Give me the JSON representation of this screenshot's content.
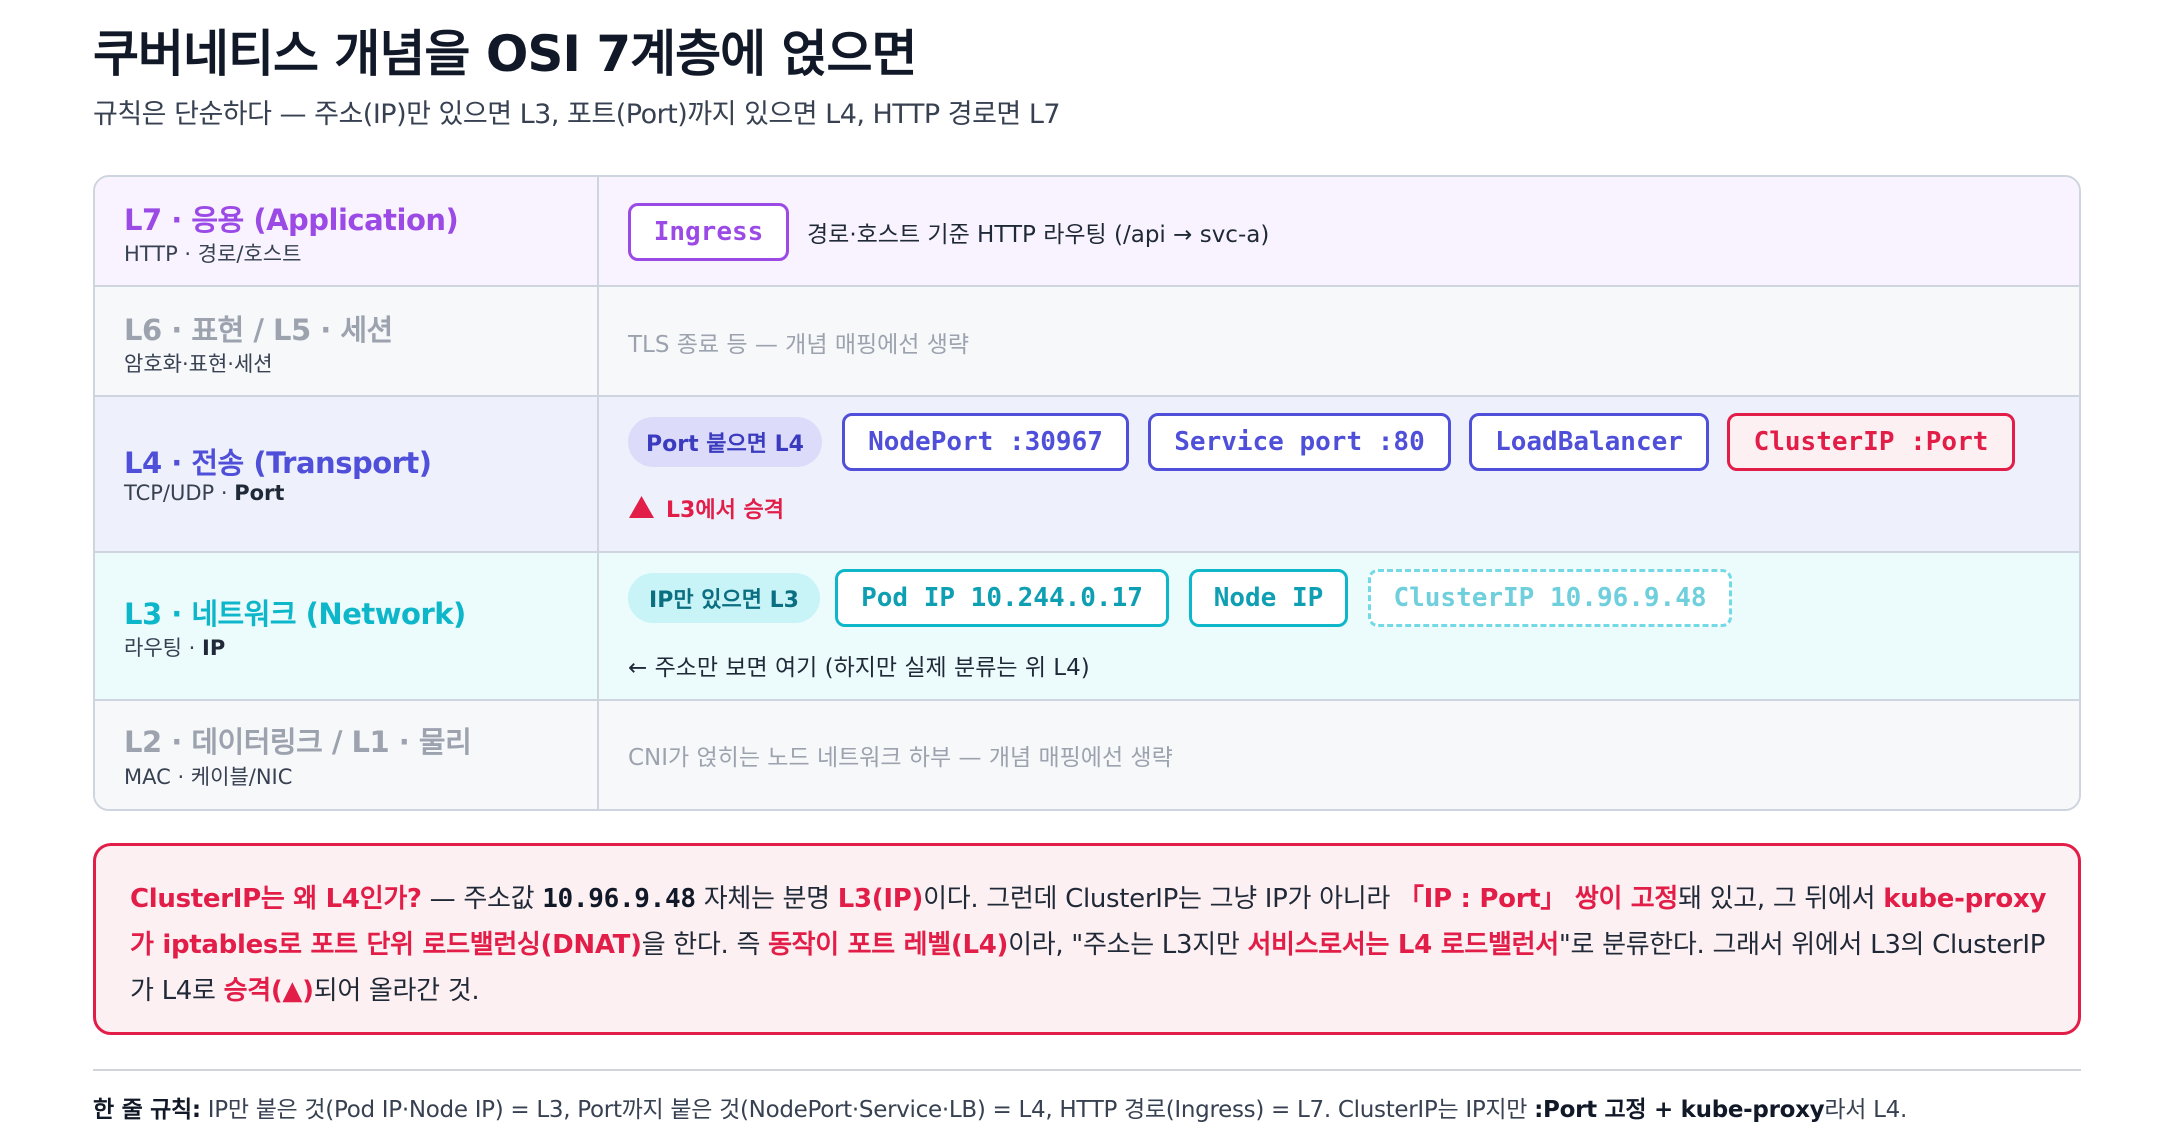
{
  "header": {
    "title": "쿠버네티스 개념을 OSI 7계층에 얹으면",
    "subtitle": "규칙은 단순하다 — 주소(IP)만 있으면 L3, 포트(Port)까지 있으면 L4, HTTP 경로면 L7"
  },
  "colors": {
    "l7": "#9b4ae6",
    "l65": "#9ca3af",
    "l4": "#4f4fd9",
    "l3": "#0eb6c9",
    "l2": "#9ca3af",
    "alert": "#e11d48"
  },
  "layers": {
    "l7": {
      "name": "L7 · 응용 (Application)",
      "sub": "HTTP · 경로/호스트",
      "chip": "Ingress",
      "desc": "경로·호스트 기준 HTTP 라우팅 (/api → svc-a)"
    },
    "l65": {
      "name": "L6 · 표현 / L5 · 세션",
      "sub": "암호화·표현·세션",
      "desc": "TLS 종료 등 — 개념 매핑에선 생략"
    },
    "l4": {
      "name": "L4 · 전송 (Transport)",
      "sub_prefix": "TCP/UDP · ",
      "sub_bold": "Port",
      "pill": "Port 붙으면 L4",
      "chips": [
        "NodePort :30967",
        "Service port :80",
        "LoadBalancer",
        "ClusterIP :Port"
      ],
      "promoted_icon": "triangle-up-icon",
      "promoted": "L3에서 승격"
    },
    "l3": {
      "name": "L3 · 네트워크 (Network)",
      "sub_prefix": "라우팅 · ",
      "sub_bold": "IP",
      "pill": "IP만 있으면 L3",
      "chips": [
        "Pod IP 10.244.0.17",
        "Node IP",
        "ClusterIP 10.96.9.48"
      ],
      "note": "← 주소만 보면 여기 (하지만 실제 분류는 위 L4)"
    },
    "l2": {
      "name": "L2 · 데이터링크 / L1 · 물리",
      "sub": "MAC · 케이블/NIC",
      "desc": "CNI가 얹히는 노드 네트워크 하부 — 개념 매핑에선 생략"
    }
  },
  "note": {
    "q": "ClusterIP는 왜 L4인가?",
    "t1": " — 주소값 ",
    "addr": "10.96.9.48",
    "t2": " 자체는 분명 ",
    "h1": "L3(IP)",
    "t3": "이다. 그런데 ClusterIP는 그냥 IP가 아니라 ",
    "h2": "「IP : Port」 쌍이 고정",
    "t4": "돼 있고, 그 뒤에서 ",
    "h3": "kube-proxy가 iptables로 포트 단위 로드밸런싱(DNAT)",
    "t5": "을 한다. 즉 ",
    "h4": "동작이 포트 레벨(L4)",
    "t6": "이라, \"주소는 L3지만 ",
    "h5": "서비스로서는 L4 로드밸런서",
    "t7": "\"로 분류한다. 그래서 위에서 L3의 ClusterIP가 L4로 ",
    "h6": "승격(▲)",
    "t8": "되어 올라간 것."
  },
  "footer": {
    "label": "한 줄 규칙:",
    "t1": " IP만 붙은 것(Pod IP·Node IP) = L3, Port까지 붙은 것(NodePort·Service·LB) = L4, HTTP 경로(Ingress) = L7. ClusterIP는 IP지만 ",
    "bold": ":Port 고정 + kube-proxy",
    "t2": "라서 L4."
  }
}
